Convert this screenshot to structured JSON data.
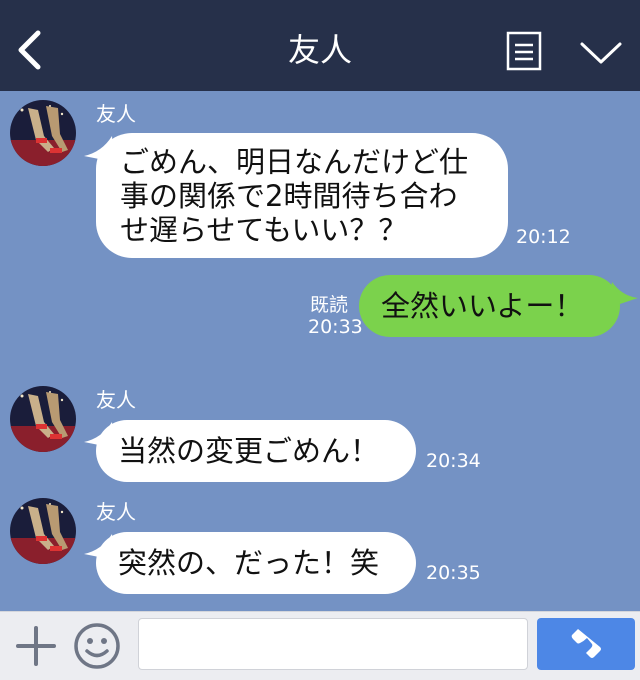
{
  "header": {
    "title": "友人",
    "back_icon": "chevron-left-icon",
    "menu_icon": "notes-icon",
    "collapse_icon": "chevron-down-icon",
    "background": "#26304a"
  },
  "chat": {
    "background": "#7492c4",
    "messages": [
      {
        "direction": "incoming",
        "sender": "友人",
        "lines": [
          "ごめん、明日なんだけど仕",
          "事の関係で2時間待ち合わ",
          "せ遅らせてもいい？？"
        ],
        "time": "20:12"
      },
      {
        "direction": "outgoing",
        "lines": [
          "全然いいよー！"
        ],
        "read_label": "既読",
        "time": "20:33"
      },
      {
        "direction": "incoming",
        "sender": "友人",
        "lines": [
          "当然の変更ごめん！"
        ],
        "time": "20:34"
      },
      {
        "direction": "incoming",
        "sender": "友人",
        "lines": [
          "突然の、だった！笑"
        ],
        "time": "20:35"
      }
    ],
    "incoming_bubble_color": "#ffffff",
    "outgoing_bubble_color": "#7bd24c"
  },
  "input_bar": {
    "plus_icon": "plus-icon",
    "emoji_icon": "smiley-icon",
    "message_value": "",
    "call_icon": "phone-icon",
    "call_button_color": "#4d87e6"
  }
}
